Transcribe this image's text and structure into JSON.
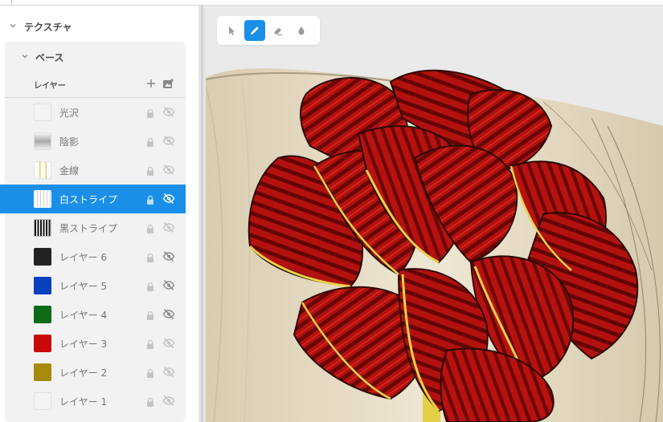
{
  "sidebar": {
    "section_title": "テクスチャ",
    "subsection_title": "ベース",
    "layers_label": "レイヤー",
    "layers": [
      {
        "label": "光沢",
        "swatch": "#f4f4f4",
        "swatch_kind": "plain-light",
        "selected": false,
        "visibility": "hidden-light"
      },
      {
        "label": "陰影",
        "swatch": "#d0d0d0",
        "swatch_kind": "gradient-gray",
        "selected": false,
        "visibility": "hidden-light"
      },
      {
        "label": "金線",
        "swatch": "#f2e29a",
        "swatch_kind": "gold-lines",
        "selected": false,
        "visibility": "hidden-light"
      },
      {
        "label": "白ストライプ",
        "swatch": "#ffffff",
        "swatch_kind": "white-stripes",
        "selected": true,
        "visibility": "hidden-dark"
      },
      {
        "label": "黒ストライプ",
        "swatch": "#111111",
        "swatch_kind": "black-stripes",
        "selected": false,
        "visibility": "hidden-light"
      },
      {
        "label": "レイヤー 6",
        "swatch": "#222222",
        "swatch_kind": "solid",
        "selected": false,
        "visibility": "hidden-dark"
      },
      {
        "label": "レイヤー 5",
        "swatch": "#0a3fbf",
        "swatch_kind": "solid",
        "selected": false,
        "visibility": "hidden-dark"
      },
      {
        "label": "レイヤー 4",
        "swatch": "#0b6b16",
        "swatch_kind": "solid",
        "selected": false,
        "visibility": "hidden-dark"
      },
      {
        "label": "レイヤー 3",
        "swatch": "#c80a0a",
        "swatch_kind": "solid",
        "selected": false,
        "visibility": "hidden-light"
      },
      {
        "label": "レイヤー 2",
        "swatch": "#a68a08",
        "swatch_kind": "solid",
        "selected": false,
        "visibility": "hidden-light"
      },
      {
        "label": "レイヤー 1",
        "swatch": "#f4f4f4",
        "swatch_kind": "solid",
        "selected": false,
        "visibility": "hidden-light"
      }
    ]
  },
  "toolbar": {
    "tools": [
      {
        "icon": "pointer-icon",
        "active": false
      },
      {
        "icon": "pencil-icon",
        "active": true
      },
      {
        "icon": "eraser-icon",
        "active": false
      },
      {
        "icon": "fill-drop-icon",
        "active": false
      }
    ]
  },
  "colors": {
    "accent": "#1a8fe8",
    "ribbon_red": "#b0100e",
    "ribbon_dark_stripe": "#6a0506",
    "ribbon_gold": "#e8d24a",
    "box_cream": "#e7ddc5"
  }
}
